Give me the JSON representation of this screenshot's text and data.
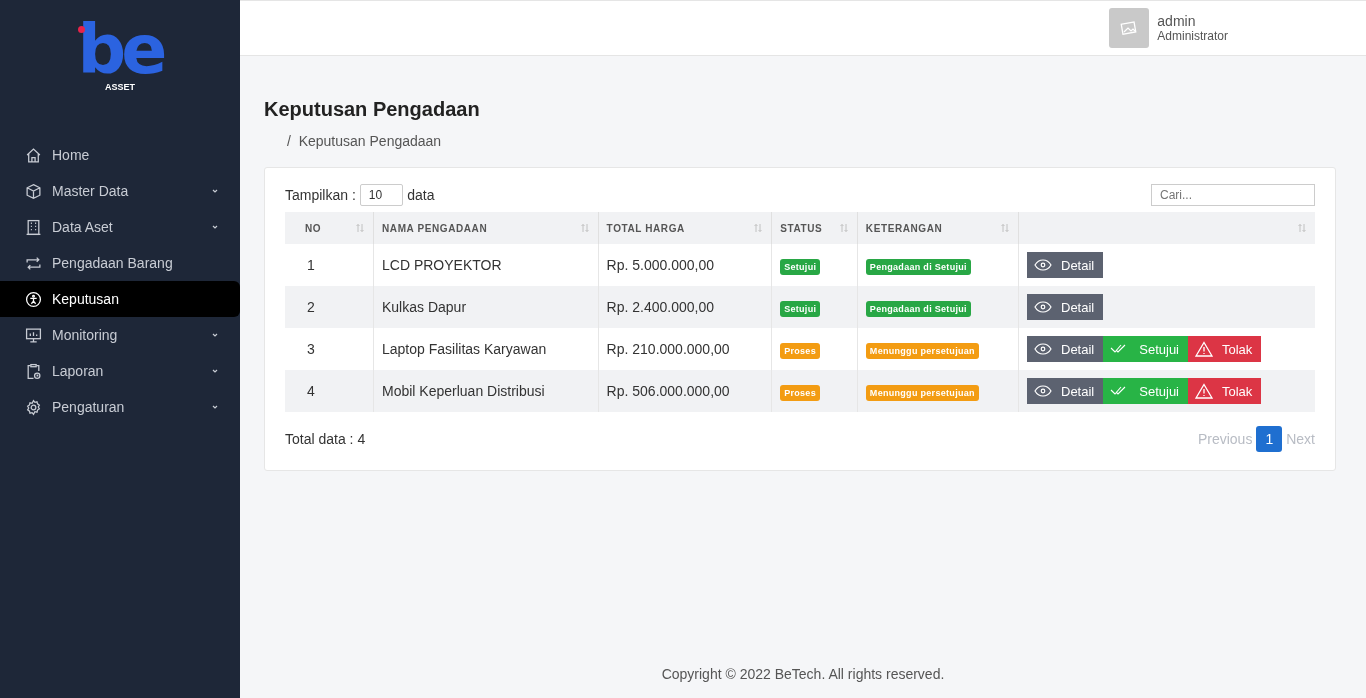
{
  "logo": {
    "mark": "be",
    "caption": "ASSET"
  },
  "sidebar": {
    "items": [
      {
        "label": "Home",
        "has_submenu": false,
        "selected": false
      },
      {
        "label": "Master Data",
        "has_submenu": true,
        "selected": false
      },
      {
        "label": "Data Aset",
        "has_submenu": true,
        "selected": false
      },
      {
        "label": "Pengadaan Barang",
        "has_submenu": false,
        "selected": false
      },
      {
        "label": "Keputusan",
        "has_submenu": false,
        "selected": true
      },
      {
        "label": "Monitoring",
        "has_submenu": true,
        "selected": false
      },
      {
        "label": "Laporan",
        "has_submenu": true,
        "selected": false
      },
      {
        "label": "Pengaturan",
        "has_submenu": true,
        "selected": false
      }
    ]
  },
  "user": {
    "name": "admin",
    "role": "Administrator"
  },
  "page": {
    "title": "Keputusan Pengadaan",
    "breadcrumb": {
      "separator": "/",
      "current": "Keputusan Pengadaan"
    }
  },
  "controls": {
    "show_label": "Tampilkan :",
    "page_size": "10",
    "show_suffix": "data",
    "search": {
      "placeholder": "Cari..."
    }
  },
  "table": {
    "columns": [
      "NO",
      "NAMA PENGADAAN",
      "TOTAL HARGA",
      "STATUS",
      "KETERANGAN",
      ""
    ],
    "rows": [
      {
        "no": "1",
        "name": "LCD PROYEKTOR",
        "total": "Rp. 5.000.000,00",
        "status": {
          "text": "Setujui",
          "kind": "approved"
        },
        "note": {
          "text": "Pengadaan di Setujui",
          "kind": "approved"
        },
        "actions": [
          {
            "label": "Detail",
            "kind": "detail"
          }
        ]
      },
      {
        "no": "2",
        "name": "Kulkas Dapur",
        "total": "Rp. 2.400.000,00",
        "status": {
          "text": "Setujui",
          "kind": "approved"
        },
        "note": {
          "text": "Pengadaan di Setujui",
          "kind": "approved"
        },
        "actions": [
          {
            "label": "Detail",
            "kind": "detail"
          }
        ]
      },
      {
        "no": "3",
        "name": "Laptop Fasilitas Karyawan",
        "total": "Rp. 210.000.000,00",
        "status": {
          "text": "Proses",
          "kind": "pending"
        },
        "note": {
          "text": "Menunggu persetujuan",
          "kind": "pending"
        },
        "actions": [
          {
            "label": "Detail",
            "kind": "detail"
          },
          {
            "label": "Setujui",
            "kind": "approve"
          },
          {
            "label": "Tolak",
            "kind": "reject"
          }
        ]
      },
      {
        "no": "4",
        "name": "Mobil Keperluan Distribusi",
        "total": "Rp. 506.000.000,00",
        "status": {
          "text": "Proses",
          "kind": "pending"
        },
        "note": {
          "text": "Menunggu persetujuan",
          "kind": "pending"
        },
        "actions": [
          {
            "label": "Detail",
            "kind": "detail"
          },
          {
            "label": "Setujui",
            "kind": "approve"
          },
          {
            "label": "Tolak",
            "kind": "reject"
          }
        ]
      }
    ]
  },
  "total": "Total data : 4",
  "pagination": {
    "previous": {
      "label": "Previous",
      "disabled": true
    },
    "pages": [
      {
        "label": "1",
        "selected": true
      }
    ],
    "next": {
      "label": "Next",
      "disabled": true
    }
  },
  "footer": "Copyright © 2022 BeTech. All rights reserved."
}
